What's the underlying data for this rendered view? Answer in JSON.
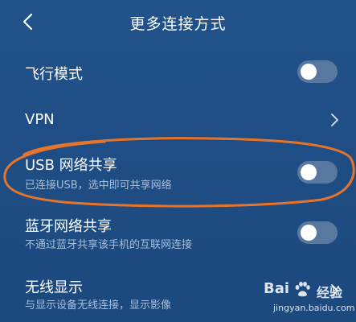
{
  "header": {
    "title": "更多连接方式",
    "back_icon": "chevron-left-icon"
  },
  "settings": [
    {
      "title": "飞行模式",
      "subtitle": "",
      "control": "toggle",
      "on": false
    },
    {
      "title": "VPN",
      "subtitle": "",
      "control": "chevron"
    },
    {
      "title": "USB 网络共享",
      "subtitle": "已连接USB，选中即可共享网络",
      "control": "toggle",
      "on": false,
      "highlighted": true
    },
    {
      "title": "蓝牙网络共享",
      "subtitle": "不通过蓝牙共享该手机的互联网连接",
      "control": "toggle",
      "on": false
    },
    {
      "title": "无线显示",
      "subtitle": "与显示设备无线连接，显示影像",
      "control": "chevron"
    }
  ],
  "watermark": {
    "logo_text": "Bai",
    "brand_text": "经验",
    "url": "jingyan.baidu.com"
  },
  "colors": {
    "background": "#1f4f86",
    "toggle_off": "#58789f",
    "subtitle": "#a9bfd9",
    "highlight_ring": "#e8742a"
  }
}
